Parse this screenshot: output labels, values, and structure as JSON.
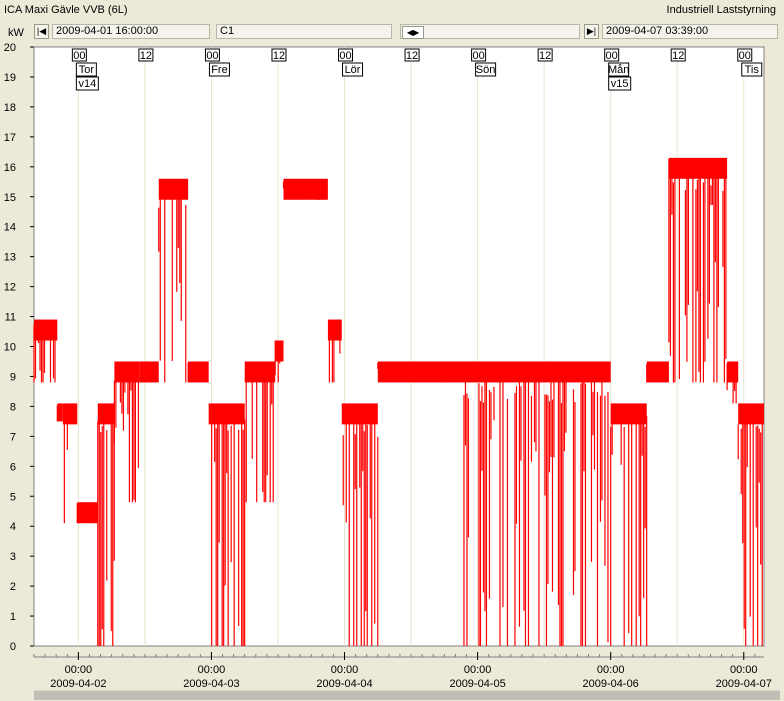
{
  "window": {
    "title": "ICA Maxi Gävle VVB (6L)",
    "app_title": "Industriell Laststyrning"
  },
  "navigation": {
    "start_time": "2009-04-01 16:00:00",
    "channel": "C1",
    "end_time": "2009-04-07 03:39:00",
    "first_icon": "skip-first-icon",
    "last_icon": "skip-last-icon",
    "scroll_icon": "left-right-arrows-icon"
  },
  "chart_data": {
    "type": "line",
    "ylabel": "kW",
    "ylim": [
      0,
      20
    ],
    "y_ticks": [
      0,
      1,
      2,
      3,
      4,
      5,
      6,
      7,
      8,
      9,
      10,
      11,
      12,
      13,
      14,
      15,
      16,
      17,
      18,
      19,
      20
    ],
    "x_start_hours": 0,
    "x_end_hours": 131.65,
    "day_markers": [
      {
        "hour": 8,
        "hh": "00",
        "day": "Tor",
        "week": "v14",
        "time": "00:00",
        "date": "2009-04-02"
      },
      {
        "hour": 20,
        "hh": "12"
      },
      {
        "hour": 32,
        "hh": "00",
        "day": "Fre",
        "time": "00:00",
        "date": "2009-04-03"
      },
      {
        "hour": 44,
        "hh": "12"
      },
      {
        "hour": 56,
        "hh": "00",
        "day": "Lör",
        "time": "00:00",
        "date": "2009-04-04"
      },
      {
        "hour": 68,
        "hh": "12"
      },
      {
        "hour": 80,
        "hh": "00",
        "day": "Sön",
        "time": "00:00",
        "date": "2009-04-05"
      },
      {
        "hour": 92,
        "hh": "12"
      },
      {
        "hour": 104,
        "hh": "00",
        "day": "Mån",
        "week": "v15",
        "time": "00:00",
        "date": "2009-04-06"
      },
      {
        "hour": 116,
        "hh": "12"
      },
      {
        "hour": 128,
        "hh": "00",
        "day": "Tis",
        "time": "00:00",
        "date": "2009-04-07"
      }
    ],
    "series": [
      {
        "color": "#ff0000",
        "envelope": [
          {
            "t0": 0,
            "t1": 4.2,
            "hi": 10.9,
            "lo": 8.8
          },
          {
            "t0": 4.2,
            "t1": 5.2,
            "hi": 8.1,
            "lo": 7.5
          },
          {
            "t0": 5.2,
            "t1": 7.8,
            "hi": 8.1,
            "lo": 4.1
          },
          {
            "t0": 7.8,
            "t1": 11.5,
            "hi": 4.8,
            "lo": 4.1
          },
          {
            "t0": 11.5,
            "t1": 14.5,
            "hi": 8.1,
            "lo": 0
          },
          {
            "t0": 14.5,
            "t1": 19.0,
            "hi": 9.5,
            "lo": 4.8
          },
          {
            "t0": 19.0,
            "t1": 22.5,
            "hi": 9.5,
            "lo": 8.8
          },
          {
            "t0": 22.5,
            "t1": 27.8,
            "hi": 15.6,
            "lo": 8.8
          },
          {
            "t0": 27.8,
            "t1": 31.5,
            "hi": 9.5,
            "lo": 8.8
          },
          {
            "t0": 31.5,
            "t1": 38.0,
            "hi": 8.1,
            "lo": 0
          },
          {
            "t0": 38.0,
            "t1": 43.5,
            "hi": 9.5,
            "lo": 4.8
          },
          {
            "t0": 43.5,
            "t1": 45.0,
            "hi": 10.2,
            "lo": 8.8
          },
          {
            "t0": 45.0,
            "t1": 53.0,
            "hi": 15.6,
            "lo": 14.9
          },
          {
            "t0": 53.0,
            "t1": 55.5,
            "hi": 10.9,
            "lo": 8.8
          },
          {
            "t0": 55.5,
            "t1": 62.0,
            "hi": 8.1,
            "lo": 0
          },
          {
            "t0": 62.0,
            "t1": 77.0,
            "hi": 9.5,
            "lo": 8.8
          },
          {
            "t0": 77.0,
            "t1": 104.0,
            "hi": 9.5,
            "lo": 0
          },
          {
            "t0": 104.0,
            "t1": 110.5,
            "hi": 8.1,
            "lo": 0
          },
          {
            "t0": 110.5,
            "t1": 114.5,
            "hi": 9.5,
            "lo": 8.8
          },
          {
            "t0": 114.5,
            "t1": 125.0,
            "hi": 16.3,
            "lo": 8.8
          },
          {
            "t0": 125.0,
            "t1": 127.0,
            "hi": 9.5,
            "lo": 8.1
          },
          {
            "t0": 127.0,
            "t1": 131.65,
            "hi": 8.1,
            "lo": 0
          }
        ]
      }
    ]
  }
}
